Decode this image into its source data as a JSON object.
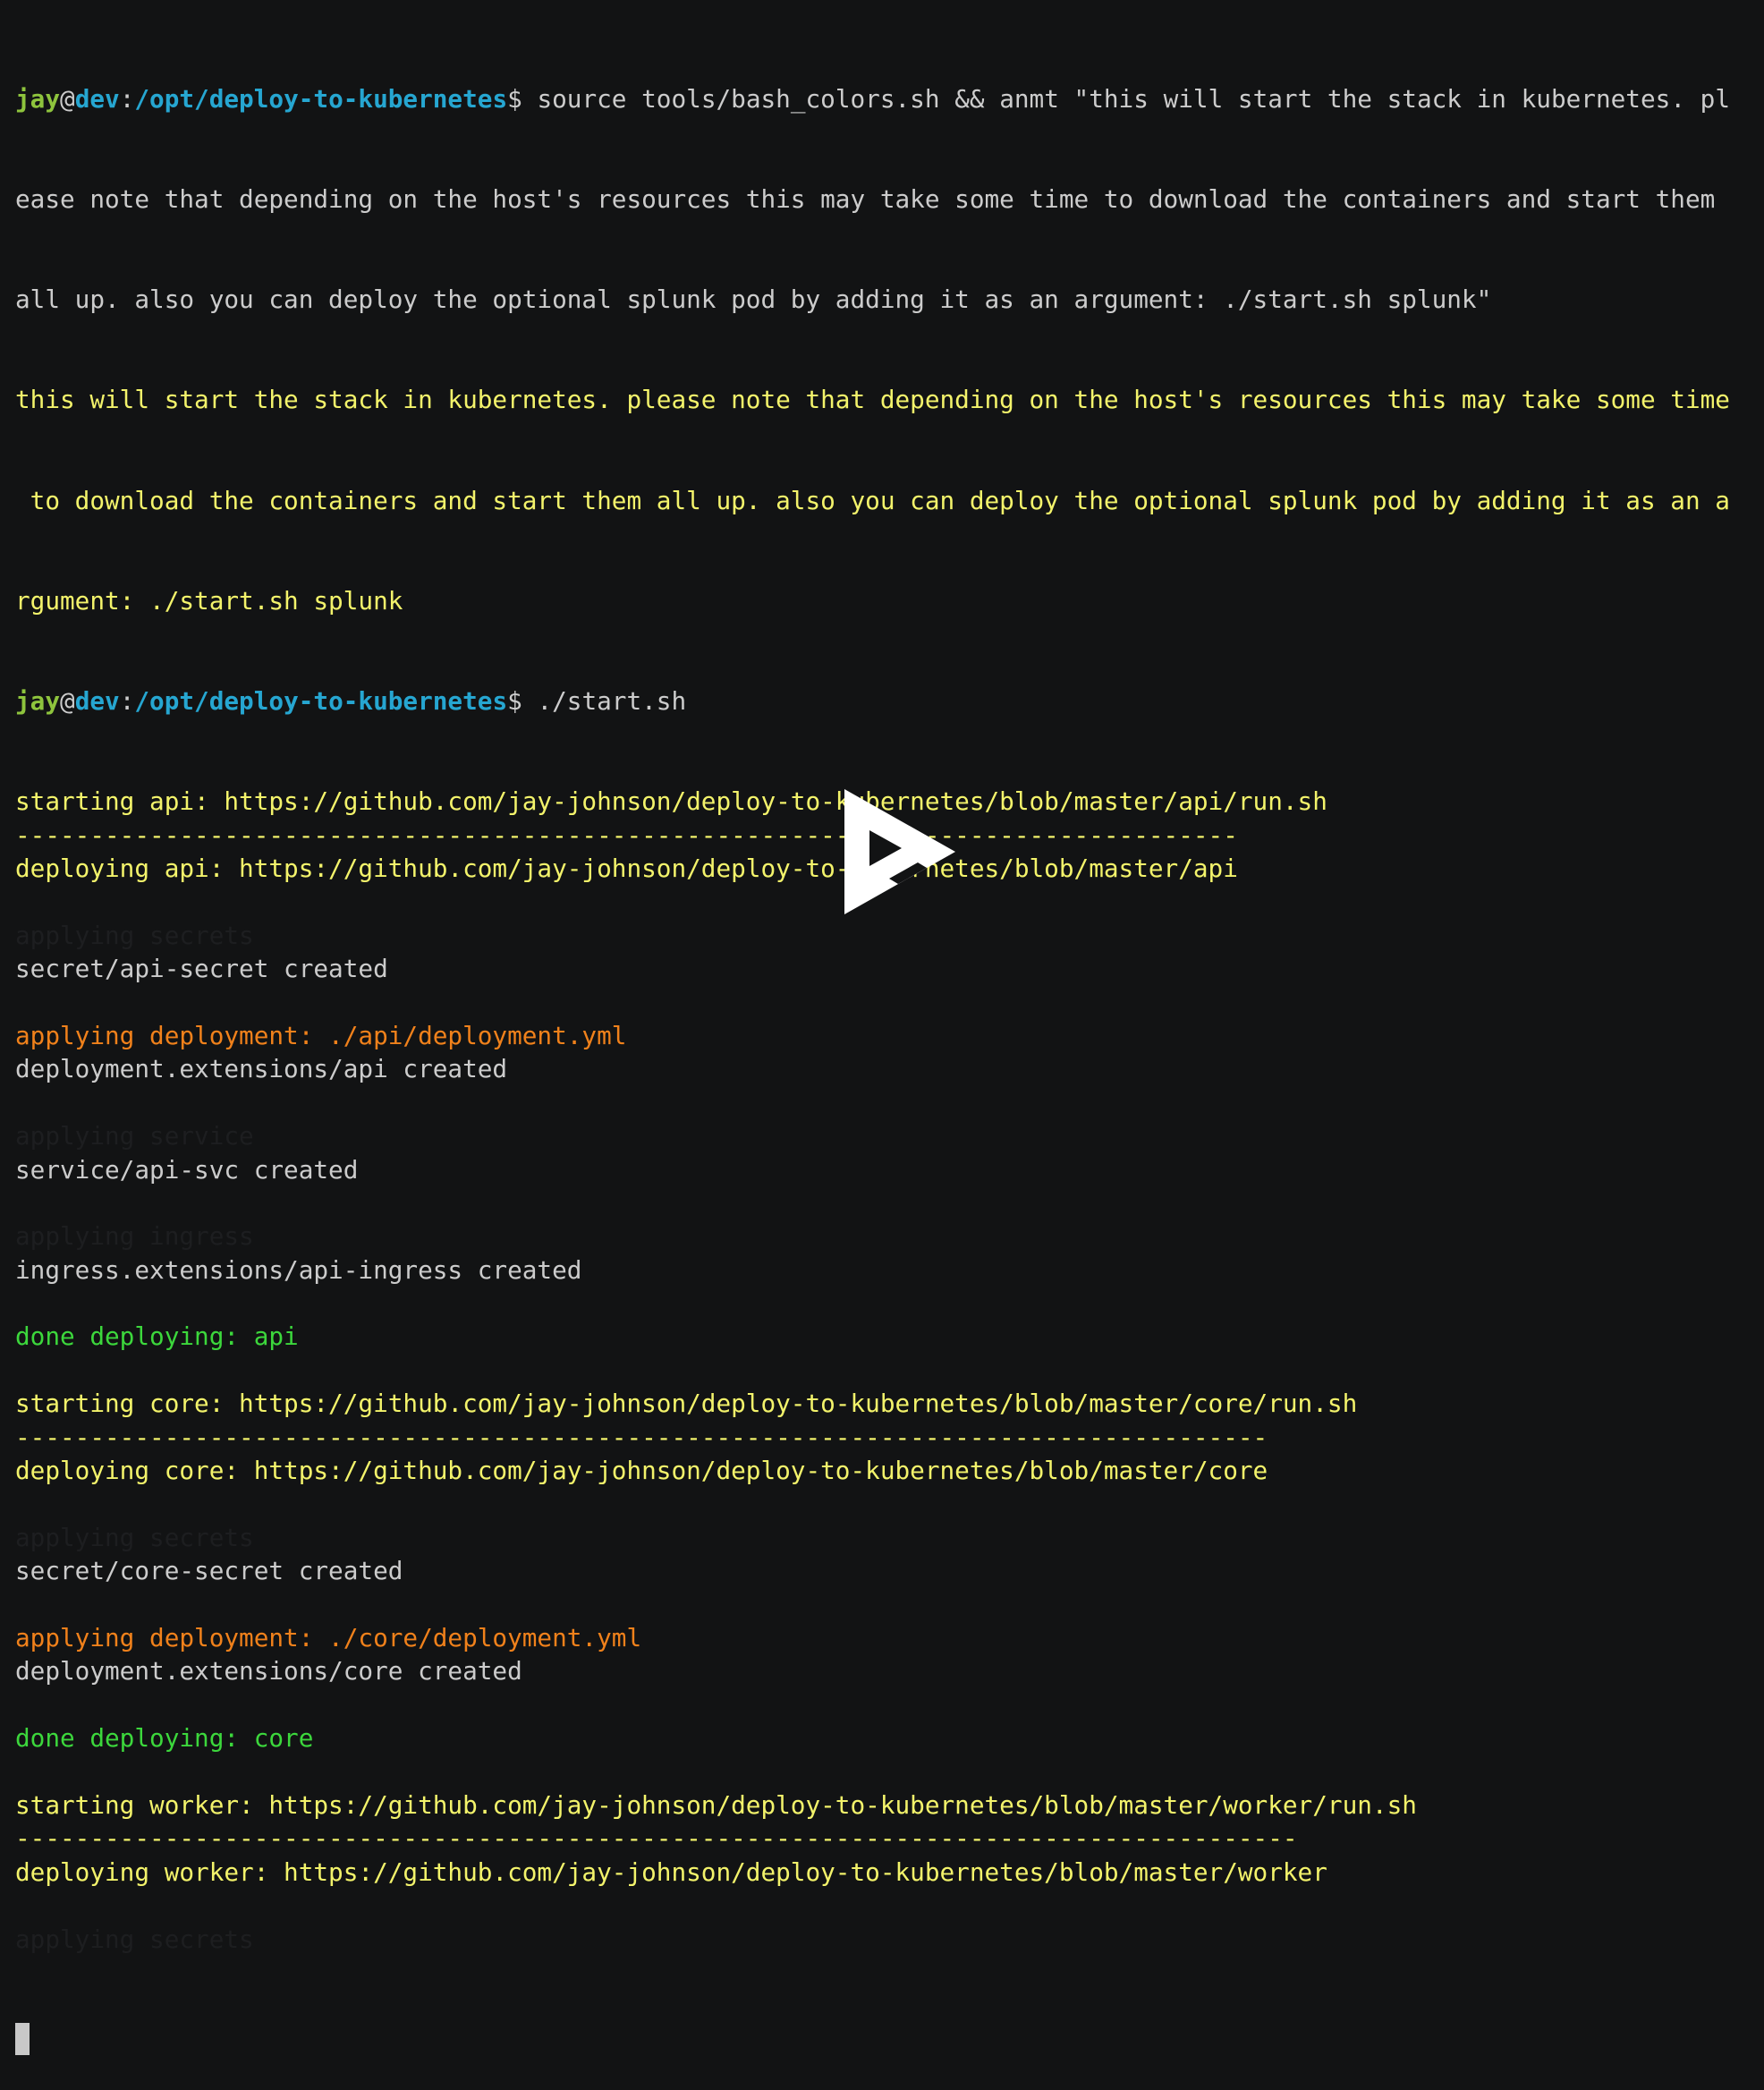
{
  "prompt": {
    "user": "jay",
    "at": "@",
    "host": "dev",
    "colon": ":",
    "path": "/opt/deploy-to-kubernetes",
    "dollar": "$ "
  },
  "command1": [
    "source tools/bash_colors.sh && anmt \"this will start the stack in kubernetes. pl",
    "ease note that depending on the host's resources this may take some time to download the containers and start them",
    "all up. also you can deploy the optional splunk pod by adding it as an argument: ./start.sh splunk\""
  ],
  "echo_output": [
    "this will start the stack in kubernetes. please note that depending on the host's resources this may take some time",
    " to download the containers and start them all up. also you can deploy the optional splunk pod by adding it as an a",
    "rgument: ./start.sh splunk"
  ],
  "command2": "./start.sh",
  "output_lines": [
    {
      "text": "starting api: https://github.com/jay-johnson/deploy-to-kubernetes/blob/master/api/run.sh",
      "color": "yellow"
    },
    {
      "text": "----------------------------------------------------------------------------------",
      "color": "yellow"
    },
    {
      "text": "deploying api: https://github.com/jay-johnson/deploy-to-kubernetes/blob/master/api",
      "color": "yellow"
    },
    {
      "text": "",
      "color": "white"
    },
    {
      "text": "applying secrets",
      "color": "dim"
    },
    {
      "text": "secret/api-secret created",
      "color": "white"
    },
    {
      "text": "",
      "color": "white"
    },
    {
      "text": "applying deployment: ./api/deployment.yml",
      "color": "orange"
    },
    {
      "text": "deployment.extensions/api created",
      "color": "white"
    },
    {
      "text": "",
      "color": "white"
    },
    {
      "text": "applying service",
      "color": "dim"
    },
    {
      "text": "service/api-svc created",
      "color": "white"
    },
    {
      "text": "",
      "color": "white"
    },
    {
      "text": "applying ingress",
      "color": "dim"
    },
    {
      "text": "ingress.extensions/api-ingress created",
      "color": "white"
    },
    {
      "text": "",
      "color": "white"
    },
    {
      "text": "done deploying: api",
      "color": "green"
    },
    {
      "text": "",
      "color": "white"
    },
    {
      "text": "starting core: https://github.com/jay-johnson/deploy-to-kubernetes/blob/master/core/run.sh",
      "color": "yellow"
    },
    {
      "text": "------------------------------------------------------------------------------------",
      "color": "yellow"
    },
    {
      "text": "deploying core: https://github.com/jay-johnson/deploy-to-kubernetes/blob/master/core",
      "color": "yellow"
    },
    {
      "text": "",
      "color": "white"
    },
    {
      "text": "applying secrets",
      "color": "dim"
    },
    {
      "text": "secret/core-secret created",
      "color": "white"
    },
    {
      "text": "",
      "color": "white"
    },
    {
      "text": "applying deployment: ./core/deployment.yml",
      "color": "orange"
    },
    {
      "text": "deployment.extensions/core created",
      "color": "white"
    },
    {
      "text": "",
      "color": "white"
    },
    {
      "text": "done deploying: core",
      "color": "green"
    },
    {
      "text": "",
      "color": "white"
    },
    {
      "text": "starting worker: https://github.com/jay-johnson/deploy-to-kubernetes/blob/master/worker/run.sh",
      "color": "yellow"
    },
    {
      "text": "--------------------------------------------------------------------------------------",
      "color": "yellow"
    },
    {
      "text": "deploying worker: https://github.com/jay-johnson/deploy-to-kubernetes/blob/master/worker",
      "color": "yellow"
    },
    {
      "text": "",
      "color": "white"
    },
    {
      "text": "applying secrets",
      "color": "dim"
    }
  ],
  "colors": {
    "background": "#121314",
    "yellow": "#f3f36b",
    "orange": "#f0811b",
    "green": "#3cd73c",
    "white": "#cccccc",
    "dim": "#1d1e20",
    "user": "#8ec43d",
    "host": "#26a6d1"
  },
  "overlay": {
    "icon": "play-icon"
  }
}
